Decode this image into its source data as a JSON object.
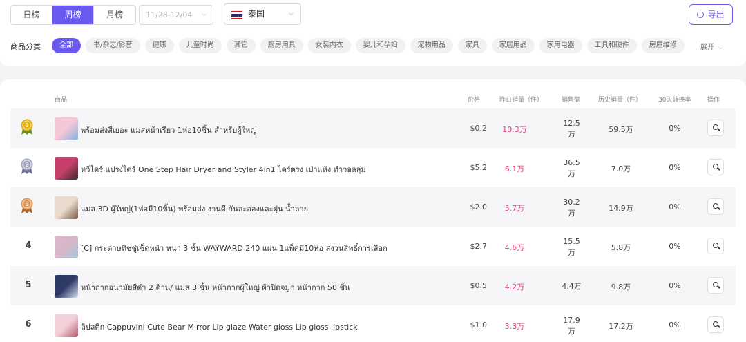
{
  "tabs": [
    {
      "label": "日榜",
      "active": false
    },
    {
      "label": "周榜",
      "active": true
    },
    {
      "label": "月榜",
      "active": false
    }
  ],
  "date_range": {
    "placeholder": "11/28-12/04"
  },
  "country": {
    "label": "泰国",
    "flag_icon": "thailand-flag-icon"
  },
  "export_button": {
    "label": "导出",
    "icon": "power-icon"
  },
  "category": {
    "label": "商品分类",
    "chips": [
      "全部",
      "书/杂志/影音",
      "健康",
      "儿童时尚",
      "其它",
      "厨房用具",
      "女装内衣",
      "婴儿和孕妇",
      "宠物用品",
      "家具",
      "家居用品",
      "家用电器",
      "工具和硬件",
      "房屋维修"
    ],
    "active_index": 0,
    "expand_label": "展开"
  },
  "table": {
    "headers": {
      "product": "商品",
      "price": "价格",
      "yesterday_sales": "昨日销量（件）",
      "sales_amount": "销售额",
      "history_sales": "历史销量（件）",
      "conversion": "30天转换率",
      "action": "操作"
    },
    "rows": [
      {
        "rank": "1",
        "medal": "gold",
        "name": "พร้อมส่งสีเยอะ แมสหน้าเรียว 1ห่อ10ชิ้น สำหรับผู้ใหญ่",
        "price": "$0.2",
        "yesterday_sales": "10.3万",
        "amount_line1": "12.5",
        "amount_line2": "万",
        "history": "59.5万",
        "rate": "0%"
      },
      {
        "rank": "2",
        "medal": "silver",
        "name": "หวีไดร์ แปรงไดร์ One Step Hair Dryer and Styler 4in1 ไดร์ตรง เป่าแห้ง ทำวอลลุ่ม",
        "price": "$5.2",
        "yesterday_sales": "6.1万",
        "amount_line1": "36.5",
        "amount_line2": "万",
        "history": "7.0万",
        "rate": "0%"
      },
      {
        "rank": "3",
        "medal": "bronze",
        "name": "แมส 3D ผู้ใหญ่(1ห่อมี10ชิ้น) พร้อมส่ง งานดี กันละอองและฝุ่น น้ำลาย",
        "price": "$2.0",
        "yesterday_sales": "5.7万",
        "amount_line1": "30.2",
        "amount_line2": "万",
        "history": "14.9万",
        "rate": "0%"
      },
      {
        "rank": "4",
        "medal": "",
        "name": "[C] กระดาษทิชชู่เช็ดหน้า หนา 3 ชั้น WAYWARD 240 แผ่น 1แพ็คมี10ห่อ สงวนสิทธิ์การเลือก",
        "price": "$2.7",
        "yesterday_sales": "4.6万",
        "amount_line1": "15.5",
        "amount_line2": "万",
        "history": "5.8万",
        "rate": "0%"
      },
      {
        "rank": "5",
        "medal": "",
        "name": "หน้ากากอนามัยสีดำ 2 ด้าน/ แมส 3 ชั้น หน้ากากผู้ใหญ่ ผ้าปิดจมูก หน้ากาก 50 ชิ้น",
        "price": "$0.5",
        "yesterday_sales": "4.2万",
        "amount_line1": "4.4万",
        "amount_line2": "",
        "history": "9.8万",
        "rate": "0%"
      },
      {
        "rank": "6",
        "medal": "",
        "name": "ลิปสติก Cappuvini Cute Bear Mirror Lip glaze Water gloss Lip gloss lipstick",
        "price": "$1.0",
        "yesterday_sales": "3.3万",
        "amount_line1": "17.9",
        "amount_line2": "万",
        "history": "17.2万",
        "rate": "0%"
      }
    ]
  },
  "colors": {
    "accent": "#6a5af0",
    "sales_pink": "#e6417f"
  }
}
